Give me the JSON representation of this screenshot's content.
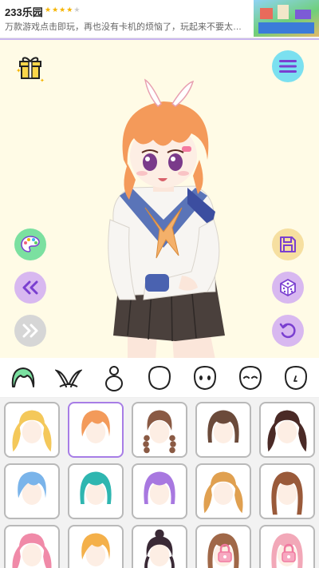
{
  "ad": {
    "title": "233乐园",
    "rating": 4,
    "rating_max": 5,
    "description": "万款游戏点击即玩，再也没有卡机的烦恼了，玩起来不要太爽..."
  },
  "stage": {
    "bg_color": "#fffbe6",
    "buttons": [
      {
        "id": "gift",
        "icon": "gift-icon"
      },
      {
        "id": "menu",
        "icon": "hamburger-menu-icon",
        "color": "#7be0f0"
      },
      {
        "id": "palette",
        "icon": "palette-icon",
        "color": "#7be0a0"
      },
      {
        "id": "save",
        "icon": "floppy-disk-icon",
        "color": "#f6dfa0"
      },
      {
        "id": "prev",
        "icon": "double-chevron-left-icon",
        "color": "#d8b8f0"
      },
      {
        "id": "random",
        "icon": "dice-icon",
        "color": "#d8b8f0"
      },
      {
        "id": "next",
        "icon": "double-chevron-right-icon",
        "color": "#d6d6d6"
      },
      {
        "id": "undo",
        "icon": "undo-icon",
        "color": "#d8b8f0"
      }
    ]
  },
  "categories": [
    {
      "id": "hair",
      "icon": "hair-icon",
      "selected": true
    },
    {
      "id": "ears",
      "icon": "bunny-ears-icon"
    },
    {
      "id": "body",
      "icon": "body-icon"
    },
    {
      "id": "face-shape",
      "icon": "face-outline-icon"
    },
    {
      "id": "eyes",
      "icon": "face-eyes-icon"
    },
    {
      "id": "expression",
      "icon": "face-closed-eyes-icon"
    },
    {
      "id": "nose",
      "icon": "face-nose-icon"
    }
  ],
  "hair_options": [
    {
      "color": "#f4c85a",
      "style": "twintails",
      "locked": false
    },
    {
      "color": "#f39a5a",
      "style": "short",
      "locked": false,
      "selected": true
    },
    {
      "color": "#8a5a44",
      "style": "braids",
      "locked": false
    },
    {
      "color": "#6b4a3a",
      "style": "bob",
      "locked": false
    },
    {
      "color": "#4a2a26",
      "style": "twintails",
      "locked": false
    },
    {
      "color": "#7ab4ea",
      "style": "short",
      "locked": false
    },
    {
      "color": "#2fb6b0",
      "style": "bob",
      "locked": false
    },
    {
      "color": "#a878e0",
      "style": "bob",
      "locked": false
    },
    {
      "color": "#e0a050",
      "style": "twintails",
      "locked": false
    },
    {
      "color": "#9a5a3a",
      "style": "long",
      "locked": false
    },
    {
      "color": "#f08aa8",
      "style": "twintails",
      "locked": false
    },
    {
      "color": "#f4b04a",
      "style": "short",
      "locked": false
    },
    {
      "color": "#3a2a36",
      "style": "bun",
      "locked": false
    },
    {
      "color": "#a06848",
      "style": "long",
      "locked": true
    },
    {
      "color": "#f2a8b8",
      "style": "long",
      "locked": true
    }
  ]
}
